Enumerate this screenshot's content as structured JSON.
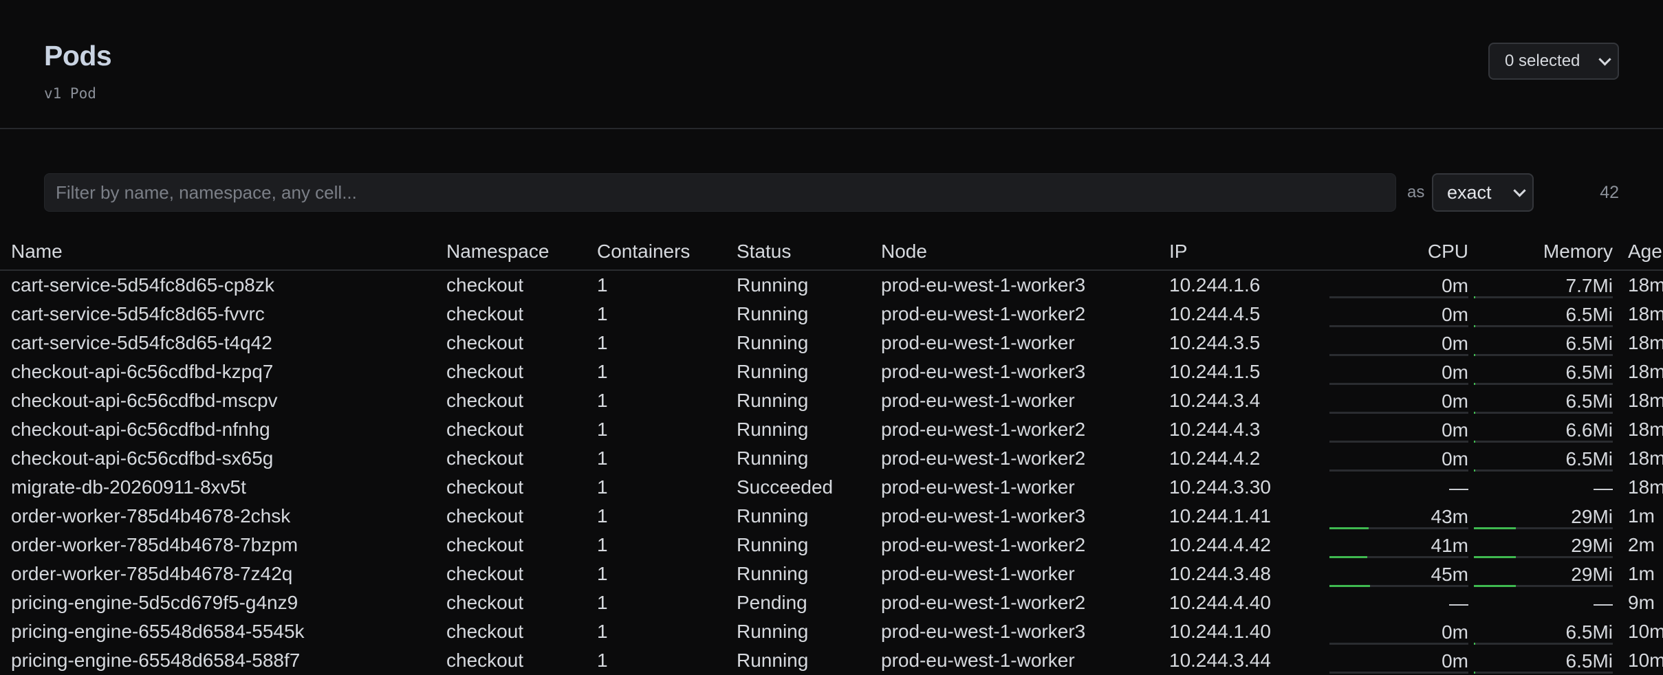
{
  "header": {
    "title": "Pods",
    "subtitle": "v1 Pod",
    "selection_label": "0 selected"
  },
  "filter": {
    "placeholder": "Filter by name, namespace, any cell...",
    "value": "",
    "as_label": "as",
    "mode": "exact",
    "count": "42"
  },
  "columns": [
    "Name",
    "Namespace",
    "Containers",
    "Status",
    "Node",
    "IP",
    "CPU",
    "Memory",
    "Age"
  ],
  "colors": {
    "bar_fill": "#3fb950",
    "bar_track": "#2a2c30",
    "background": "#0b0b0c"
  },
  "rows": [
    {
      "name": "cart-service-5d54fc8d65-cp8zk",
      "namespace": "checkout",
      "containers": "1",
      "status": "Running",
      "node": "prod-eu-west-1-worker3",
      "ip": "10.244.1.6",
      "cpu": "0m",
      "cpu_frac": 0,
      "memory": "7.7Mi",
      "mem_frac": 0.012,
      "age": "18m"
    },
    {
      "name": "cart-service-5d54fc8d65-fvvrc",
      "namespace": "checkout",
      "containers": "1",
      "status": "Running",
      "node": "prod-eu-west-1-worker2",
      "ip": "10.244.4.5",
      "cpu": "0m",
      "cpu_frac": 0,
      "memory": "6.5Mi",
      "mem_frac": 0.01,
      "age": "18m"
    },
    {
      "name": "cart-service-5d54fc8d65-t4q42",
      "namespace": "checkout",
      "containers": "1",
      "status": "Running",
      "node": "prod-eu-west-1-worker",
      "ip": "10.244.3.5",
      "cpu": "0m",
      "cpu_frac": 0,
      "memory": "6.5Mi",
      "mem_frac": 0.01,
      "age": "18m"
    },
    {
      "name": "checkout-api-6c56cdfbd-kzpq7",
      "namespace": "checkout",
      "containers": "1",
      "status": "Running",
      "node": "prod-eu-west-1-worker3",
      "ip": "10.244.1.5",
      "cpu": "0m",
      "cpu_frac": 0,
      "memory": "6.5Mi",
      "mem_frac": 0.01,
      "age": "18m"
    },
    {
      "name": "checkout-api-6c56cdfbd-mscpv",
      "namespace": "checkout",
      "containers": "1",
      "status": "Running",
      "node": "prod-eu-west-1-worker",
      "ip": "10.244.3.4",
      "cpu": "0m",
      "cpu_frac": 0,
      "memory": "6.5Mi",
      "mem_frac": 0.01,
      "age": "18m"
    },
    {
      "name": "checkout-api-6c56cdfbd-nfnhg",
      "namespace": "checkout",
      "containers": "1",
      "status": "Running",
      "node": "prod-eu-west-1-worker2",
      "ip": "10.244.4.3",
      "cpu": "0m",
      "cpu_frac": 0,
      "memory": "6.6Mi",
      "mem_frac": 0.01,
      "age": "18m"
    },
    {
      "name": "checkout-api-6c56cdfbd-sx65g",
      "namespace": "checkout",
      "containers": "1",
      "status": "Running",
      "node": "prod-eu-west-1-worker2",
      "ip": "10.244.4.2",
      "cpu": "0m",
      "cpu_frac": 0,
      "memory": "6.5Mi",
      "mem_frac": 0.01,
      "age": "18m"
    },
    {
      "name": "migrate-db-20260911-8xv5t",
      "namespace": "checkout",
      "containers": "1",
      "status": "Succeeded",
      "node": "prod-eu-west-1-worker",
      "ip": "10.244.3.30",
      "cpu": "—",
      "cpu_frac": null,
      "memory": "—",
      "mem_frac": null,
      "age": "18m"
    },
    {
      "name": "order-worker-785d4b4678-2chsk",
      "namespace": "checkout",
      "containers": "1",
      "status": "Running",
      "node": "prod-eu-west-1-worker3",
      "ip": "10.244.1.41",
      "cpu": "43m",
      "cpu_frac": 0.28,
      "memory": "29Mi",
      "mem_frac": 0.3,
      "age": "1m"
    },
    {
      "name": "order-worker-785d4b4678-7bzpm",
      "namespace": "checkout",
      "containers": "1",
      "status": "Running",
      "node": "prod-eu-west-1-worker2",
      "ip": "10.244.4.42",
      "cpu": "41m",
      "cpu_frac": 0.27,
      "memory": "29Mi",
      "mem_frac": 0.3,
      "age": "2m"
    },
    {
      "name": "order-worker-785d4b4678-7z42q",
      "namespace": "checkout",
      "containers": "1",
      "status": "Running",
      "node": "prod-eu-west-1-worker",
      "ip": "10.244.3.48",
      "cpu": "45m",
      "cpu_frac": 0.29,
      "memory": "29Mi",
      "mem_frac": 0.3,
      "age": "1m"
    },
    {
      "name": "pricing-engine-5d5cd679f5-g4nz9",
      "namespace": "checkout",
      "containers": "1",
      "status": "Pending",
      "node": "prod-eu-west-1-worker2",
      "ip": "10.244.4.40",
      "cpu": "—",
      "cpu_frac": null,
      "memory": "—",
      "mem_frac": null,
      "age": "9m"
    },
    {
      "name": "pricing-engine-65548d6584-5545k",
      "namespace": "checkout",
      "containers": "1",
      "status": "Running",
      "node": "prod-eu-west-1-worker3",
      "ip": "10.244.1.40",
      "cpu": "0m",
      "cpu_frac": 0,
      "memory": "6.5Mi",
      "mem_frac": 0.01,
      "age": "10m"
    },
    {
      "name": "pricing-engine-65548d6584-588f7",
      "namespace": "checkout",
      "containers": "1",
      "status": "Running",
      "node": "prod-eu-west-1-worker",
      "ip": "10.244.3.44",
      "cpu": "0m",
      "cpu_frac": 0,
      "memory": "6.5Mi",
      "mem_frac": 0.01,
      "age": "10m"
    }
  ]
}
